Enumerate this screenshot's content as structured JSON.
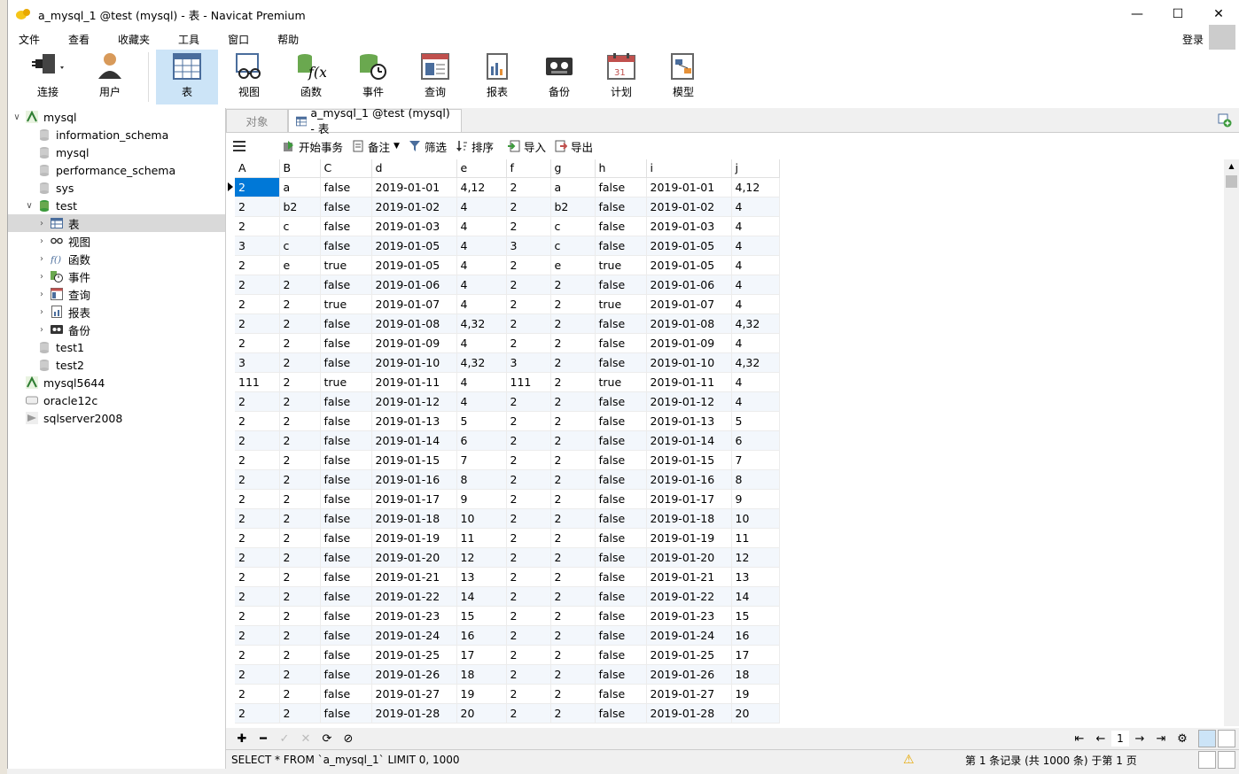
{
  "window": {
    "title": "a_mysql_1 @test (mysql) - 表 - Navicat Premium"
  },
  "menu": [
    "文件",
    "查看",
    "收藏夹",
    "工具",
    "窗口",
    "帮助"
  ],
  "login": "登录",
  "toolbar": [
    {
      "label": "连接",
      "icon": "plug-icon"
    },
    {
      "label": "用户",
      "icon": "user-icon"
    },
    {
      "label": "表",
      "icon": "table-icon",
      "active": true
    },
    {
      "label": "视图",
      "icon": "view-icon"
    },
    {
      "label": "函数",
      "icon": "function-icon"
    },
    {
      "label": "事件",
      "icon": "event-icon"
    },
    {
      "label": "查询",
      "icon": "query-icon"
    },
    {
      "label": "报表",
      "icon": "report-icon"
    },
    {
      "label": "备份",
      "icon": "backup-icon"
    },
    {
      "label": "计划",
      "icon": "schedule-icon"
    },
    {
      "label": "模型",
      "icon": "model-icon"
    }
  ],
  "tree": [
    {
      "label": "mysql",
      "level": 0,
      "caret": "v",
      "icon": "mysql-connection-icon"
    },
    {
      "label": "information_schema",
      "level": 1,
      "icon": "database-icon"
    },
    {
      "label": "mysql",
      "level": 1,
      "icon": "database-icon"
    },
    {
      "label": "performance_schema",
      "level": 1,
      "icon": "database-icon"
    },
    {
      "label": "sys",
      "level": 1,
      "icon": "database-icon"
    },
    {
      "label": "test",
      "level": 1,
      "caret": "v",
      "icon": "database-open-icon"
    },
    {
      "label": "表",
      "level": 2,
      "caret": ">",
      "icon": "table-icon",
      "selected": true
    },
    {
      "label": "视图",
      "level": 2,
      "caret": ">",
      "icon": "view-icon"
    },
    {
      "label": "函数",
      "level": 2,
      "caret": ">",
      "icon": "function-icon"
    },
    {
      "label": "事件",
      "level": 2,
      "caret": ">",
      "icon": "event-icon"
    },
    {
      "label": "查询",
      "level": 2,
      "caret": ">",
      "icon": "query-icon"
    },
    {
      "label": "报表",
      "level": 2,
      "caret": ">",
      "icon": "report-icon"
    },
    {
      "label": "备份",
      "level": 2,
      "caret": ">",
      "icon": "backup-icon"
    },
    {
      "label": "test1",
      "level": 1,
      "icon": "database-icon"
    },
    {
      "label": "test2",
      "level": 1,
      "icon": "database-icon"
    },
    {
      "label": "mysql5644",
      "level": 0,
      "icon": "mysql-connection-icon"
    },
    {
      "label": "oracle12c",
      "level": 0,
      "icon": "oracle-connection-icon"
    },
    {
      "label": "sqlserver2008",
      "level": 0,
      "icon": "sqlserver-connection-icon"
    }
  ],
  "tabs": {
    "objects": "对象",
    "active": "a_mysql_1 @test (mysql) - 表"
  },
  "subtoolbar": [
    "开始事务",
    "备注",
    "筛选",
    "排序",
    "导入",
    "导出"
  ],
  "grid": {
    "columns": [
      "A",
      "B",
      "C",
      "d",
      "e",
      "f",
      "g",
      "h",
      "i",
      "j"
    ],
    "rows": [
      [
        "2",
        "a",
        "false",
        "2019-01-01",
        "4,12",
        "2",
        "a",
        "false",
        "2019-01-01",
        "4,12"
      ],
      [
        "2",
        "b2",
        "false",
        "2019-01-02",
        "4",
        "2",
        "b2",
        "false",
        "2019-01-02",
        "4"
      ],
      [
        "2",
        "c",
        "false",
        "2019-01-03",
        "4",
        "2",
        "c",
        "false",
        "2019-01-03",
        "4"
      ],
      [
        "3",
        "c",
        "false",
        "2019-01-05",
        "4",
        "3",
        "c",
        "false",
        "2019-01-05",
        "4"
      ],
      [
        "2",
        "e",
        "true",
        "2019-01-05",
        "4",
        "2",
        "e",
        "true",
        "2019-01-05",
        "4"
      ],
      [
        "2",
        "2",
        "false",
        "2019-01-06",
        "4",
        "2",
        "2",
        "false",
        "2019-01-06",
        "4"
      ],
      [
        "2",
        "2",
        "true",
        "2019-01-07",
        "4",
        "2",
        "2",
        "true",
        "2019-01-07",
        "4"
      ],
      [
        "2",
        "2",
        "false",
        "2019-01-08",
        "4,32",
        "2",
        "2",
        "false",
        "2019-01-08",
        "4,32"
      ],
      [
        "2",
        "2",
        "false",
        "2019-01-09",
        "4",
        "2",
        "2",
        "false",
        "2019-01-09",
        "4"
      ],
      [
        "3",
        "2",
        "false",
        "2019-01-10",
        "4,32",
        "3",
        "2",
        "false",
        "2019-01-10",
        "4,32"
      ],
      [
        "111",
        "2",
        "true",
        "2019-01-11",
        "4",
        "111",
        "2",
        "true",
        "2019-01-11",
        "4"
      ],
      [
        "2",
        "2",
        "false",
        "2019-01-12",
        "4",
        "2",
        "2",
        "false",
        "2019-01-12",
        "4"
      ],
      [
        "2",
        "2",
        "false",
        "2019-01-13",
        "5",
        "2",
        "2",
        "false",
        "2019-01-13",
        "5"
      ],
      [
        "2",
        "2",
        "false",
        "2019-01-14",
        "6",
        "2",
        "2",
        "false",
        "2019-01-14",
        "6"
      ],
      [
        "2",
        "2",
        "false",
        "2019-01-15",
        "7",
        "2",
        "2",
        "false",
        "2019-01-15",
        "7"
      ],
      [
        "2",
        "2",
        "false",
        "2019-01-16",
        "8",
        "2",
        "2",
        "false",
        "2019-01-16",
        "8"
      ],
      [
        "2",
        "2",
        "false",
        "2019-01-17",
        "9",
        "2",
        "2",
        "false",
        "2019-01-17",
        "9"
      ],
      [
        "2",
        "2",
        "false",
        "2019-01-18",
        "10",
        "2",
        "2",
        "false",
        "2019-01-18",
        "10"
      ],
      [
        "2",
        "2",
        "false",
        "2019-01-19",
        "11",
        "2",
        "2",
        "false",
        "2019-01-19",
        "11"
      ],
      [
        "2",
        "2",
        "false",
        "2019-01-20",
        "12",
        "2",
        "2",
        "false",
        "2019-01-20",
        "12"
      ],
      [
        "2",
        "2",
        "false",
        "2019-01-21",
        "13",
        "2",
        "2",
        "false",
        "2019-01-21",
        "13"
      ],
      [
        "2",
        "2",
        "false",
        "2019-01-22",
        "14",
        "2",
        "2",
        "false",
        "2019-01-22",
        "14"
      ],
      [
        "2",
        "2",
        "false",
        "2019-01-23",
        "15",
        "2",
        "2",
        "false",
        "2019-01-23",
        "15"
      ],
      [
        "2",
        "2",
        "false",
        "2019-01-24",
        "16",
        "2",
        "2",
        "false",
        "2019-01-24",
        "16"
      ],
      [
        "2",
        "2",
        "false",
        "2019-01-25",
        "17",
        "2",
        "2",
        "false",
        "2019-01-25",
        "17"
      ],
      [
        "2",
        "2",
        "false",
        "2019-01-26",
        "18",
        "2",
        "2",
        "false",
        "2019-01-26",
        "18"
      ],
      [
        "2",
        "2",
        "false",
        "2019-01-27",
        "19",
        "2",
        "2",
        "false",
        "2019-01-27",
        "19"
      ],
      [
        "2",
        "2",
        "false",
        "2019-01-28",
        "20",
        "2",
        "2",
        "false",
        "2019-01-28",
        "20"
      ]
    ]
  },
  "pager": {
    "page": "1"
  },
  "status": {
    "sql": "SELECT * FROM `a_mysql_1` LIMIT 0, 1000",
    "records": "第 1 条记录 (共 1000 条) 于第 1 页"
  },
  "colors": {
    "accent": "#0078d7",
    "selected_tab": "#cce4f7"
  }
}
